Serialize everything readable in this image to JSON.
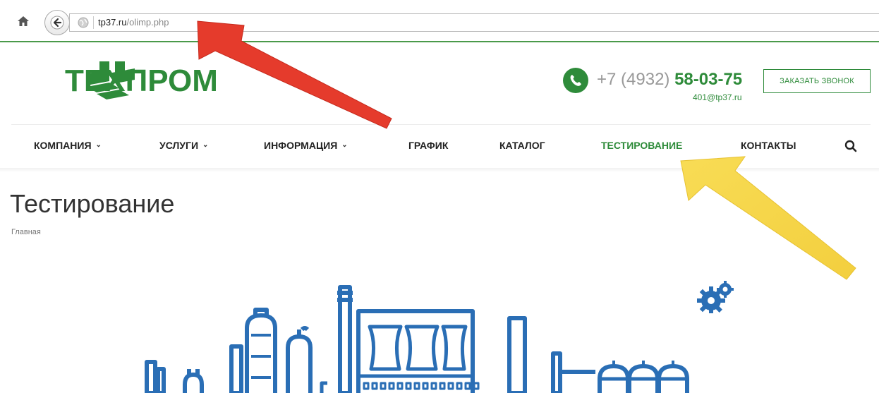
{
  "browser": {
    "url_domain": "tp37.ru",
    "url_path": "/olimp.php"
  },
  "header": {
    "logo_text": "ТЕХПРОМ",
    "phone_prefix": "+7 (4932)",
    "phone_number": "58-03-75",
    "email": "401@tp37.ru",
    "callback_label": "ЗАКАЗАТЬ ЗВОНОК"
  },
  "nav": {
    "items": [
      {
        "label": "КОМПАНИЯ",
        "dropdown": true
      },
      {
        "label": "УСЛУГИ",
        "dropdown": true
      },
      {
        "label": "ИНФОРМАЦИЯ",
        "dropdown": true
      },
      {
        "label": "ГРАФИК",
        "dropdown": false
      },
      {
        "label": "КАТАЛОГ",
        "dropdown": false
      },
      {
        "label": "ТЕСТИРОВАНИЕ",
        "dropdown": false,
        "active": true
      },
      {
        "label": "КОНТАКТЫ",
        "dropdown": false
      }
    ],
    "caret_glyph": "⌄"
  },
  "page": {
    "title": "Тестирование",
    "breadcrumb": "Главная"
  },
  "colors": {
    "brand_green": "#2e8b3a",
    "illustration_blue": "#2a6eb5",
    "arrow_red": "#e53b2c",
    "arrow_yellow": "#f6d649"
  }
}
